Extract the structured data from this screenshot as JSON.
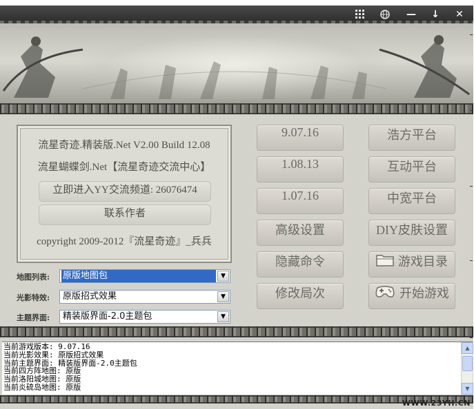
{
  "titlebar": {
    "icons": [
      "grid-icon",
      "globe-icon",
      "minimize-icon",
      "download-icon",
      "close-icon"
    ],
    "minimize_label": "—",
    "download_label": "↓",
    "close_label": "✕"
  },
  "info": {
    "line1": "流星奇迹.精装版.Net  V2.00 Build 12.08",
    "line2": "流星蝴蝶剑.Net【流星奇迹交流中心】",
    "yy_button": "立即进入YY交流频道: 26076474",
    "contact_button": "联系作者",
    "copyright": "copyright 2009-2012『流星奇迹』_兵兵"
  },
  "fields": [
    {
      "label": "地图列表:",
      "value": "原版地图包",
      "selected": true
    },
    {
      "label": "光影特效:",
      "value": "原版招式效果",
      "selected": false
    },
    {
      "label": "主题界面:",
      "value": "精装版界面-2.0主题包",
      "selected": false
    }
  ],
  "version_buttons": [
    "9.07.16",
    "1.08.13",
    "1.07.16"
  ],
  "left_action_buttons": [
    "高级设置",
    "隐藏命令",
    "修改局次"
  ],
  "platform_buttons": [
    "浩方平台",
    "互动平台",
    "中宽平台"
  ],
  "diy_button": "DIY皮肤设置",
  "game_dir_button": {
    "label": "游戏目录",
    "icon": "folder-icon"
  },
  "start_button": {
    "label": "开始游戏",
    "icon": "gamepad-icon"
  },
  "log_lines": [
    "当前游戏版本: 9.07.16",
    "当前光影效果: 原版招式效果",
    "当前主题界面: 精装版界面-2.0主题包",
    "当前四方阵地图: 原版",
    "当前洛阳城地图: 原版",
    "当前炎硫岛地图: 原版"
  ],
  "watermark": "WWW.23YH.CN",
  "colors": {
    "selection": "#316ac5",
    "panel": "#d3d3cc",
    "titlebar": "#2b2b2b"
  }
}
